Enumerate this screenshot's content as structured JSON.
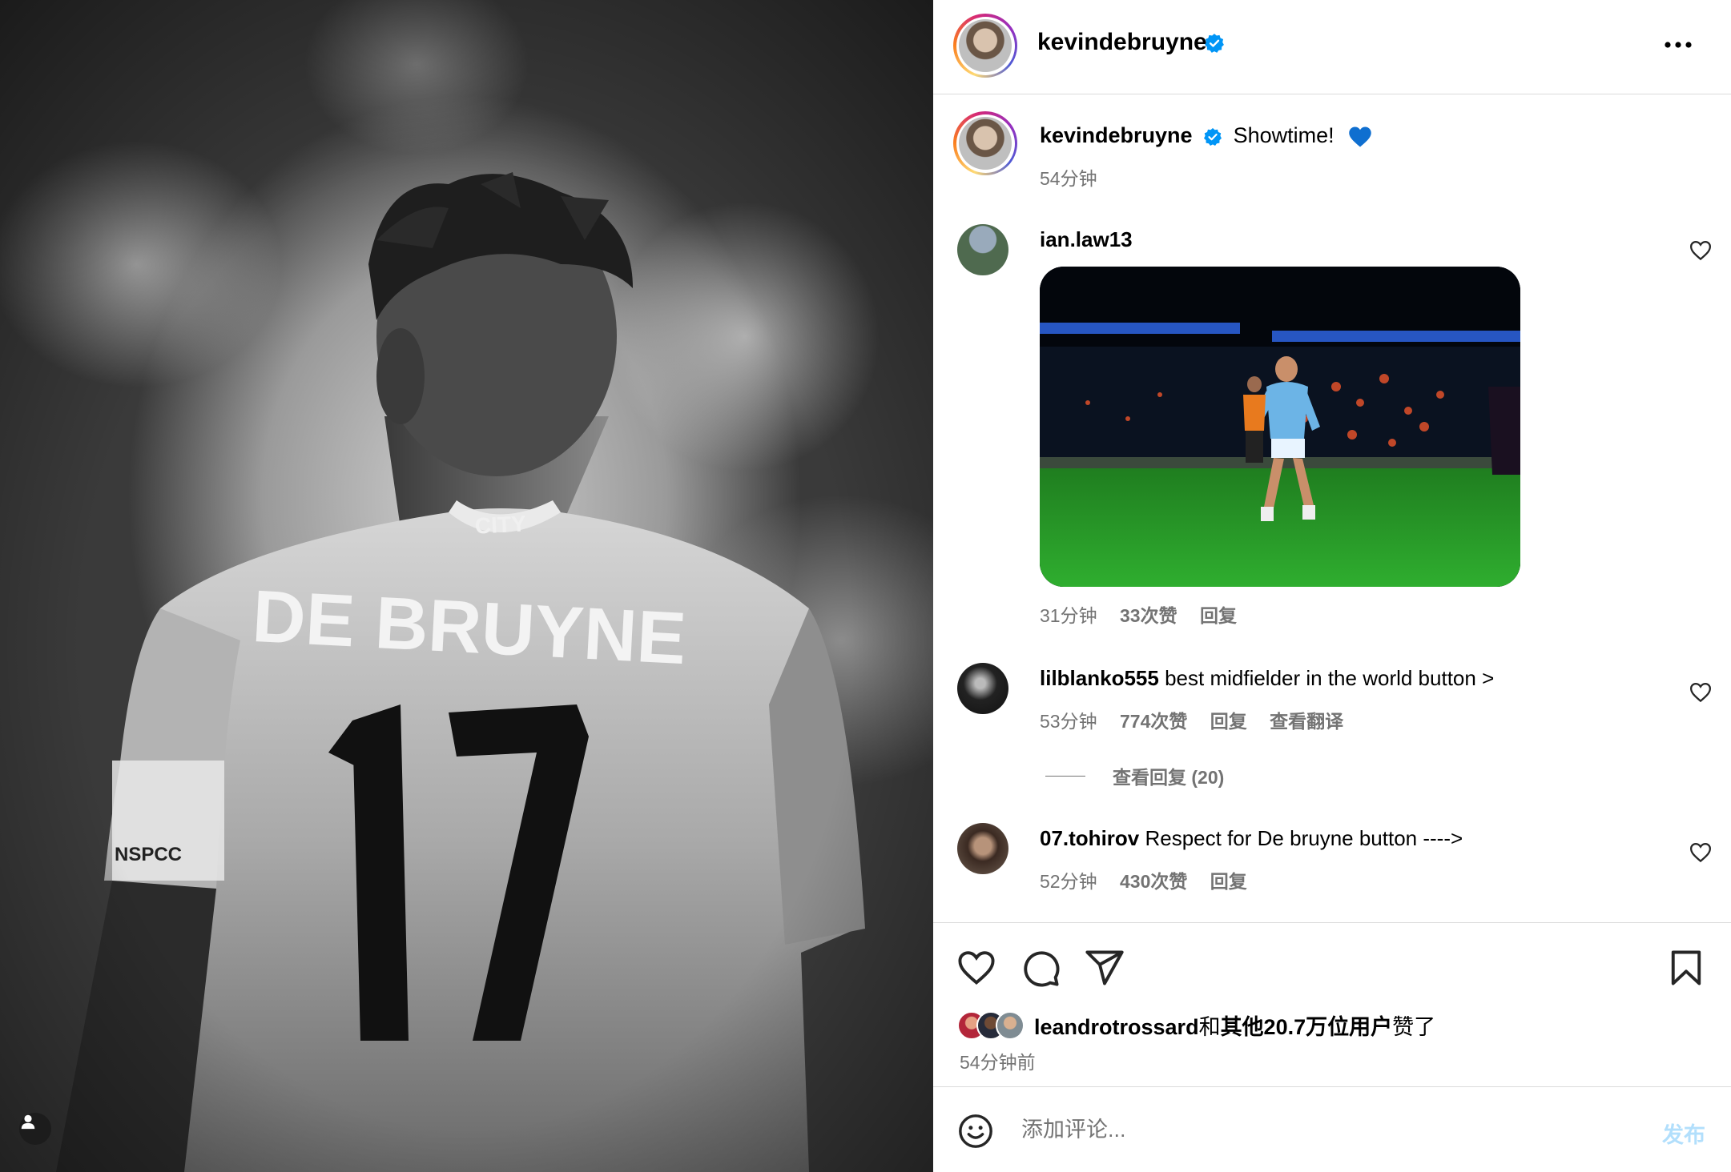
{
  "photo": {
    "jersey_text": "DE BRUYNE",
    "jersey_number": "17",
    "collar_text": "CITY",
    "sleeve_patch": "NSPCC"
  },
  "header": {
    "username": "kevindebruyne",
    "more_icon": "more-horizontal-icon"
  },
  "caption": {
    "username": "kevindebruyne",
    "text": "Showtime!",
    "emoji": "blue-heart",
    "time": "54分钟"
  },
  "comments": [
    {
      "username": "ian.law13",
      "text": "",
      "time": "31分钟",
      "likes": "33次赞",
      "reply": "回复"
    },
    {
      "username": "lilblanko555",
      "text": "best midfielder in the world button >",
      "time": "53分钟",
      "likes": "774次赞",
      "reply": "回复",
      "translate": "查看翻译"
    },
    {
      "username": "07.tohirov",
      "text": "Respect for De bruyne button ---->",
      "time": "52分钟",
      "likes": "430次赞",
      "reply": "回复"
    }
  ],
  "view_replies": "查看回复 (20)",
  "likes_summary": {
    "user": "leandrotrossard",
    "and": "和",
    "others": "其他20.7万位用户",
    "suffix": "赞了"
  },
  "post_time": "54分钟前",
  "composer": {
    "placeholder": "添加评论...",
    "post_label": "发布"
  },
  "colors": {
    "verified": "#0095f6",
    "heart_blue": "#0f6fd0",
    "muted": "#737373",
    "post_disabled": "#b2dffc"
  }
}
